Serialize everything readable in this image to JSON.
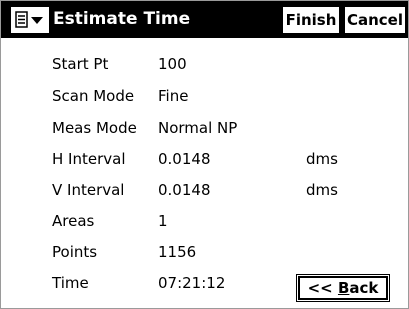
{
  "window": {
    "title": "Estimate Time",
    "menu_icon": "menu-list-icon",
    "buttons": {
      "finish": "Finish",
      "cancel": "Cancel"
    }
  },
  "fields": [
    {
      "label": "Start Pt",
      "value": "100",
      "unit": ""
    },
    {
      "label": "Scan Mode",
      "value": "Fine",
      "unit": ""
    },
    {
      "label": "Meas Mode",
      "value": "Normal NP",
      "unit": ""
    },
    {
      "label": "H Interval",
      "value": "0.0148",
      "unit": "dms"
    },
    {
      "label": "V Interval",
      "value": "0.0148",
      "unit": "dms"
    },
    {
      "label": "Areas",
      "value": "1",
      "unit": ""
    },
    {
      "label": "Points",
      "value": "1156",
      "unit": ""
    },
    {
      "label": "Time",
      "value": "07:21:12",
      "unit": ""
    }
  ],
  "back_button": {
    "prefix": "<< ",
    "accel": "B",
    "rest": "ack"
  },
  "colors": {
    "titlebar": "#000000",
    "title_text": "#ffffff",
    "background": "#ffffff"
  }
}
